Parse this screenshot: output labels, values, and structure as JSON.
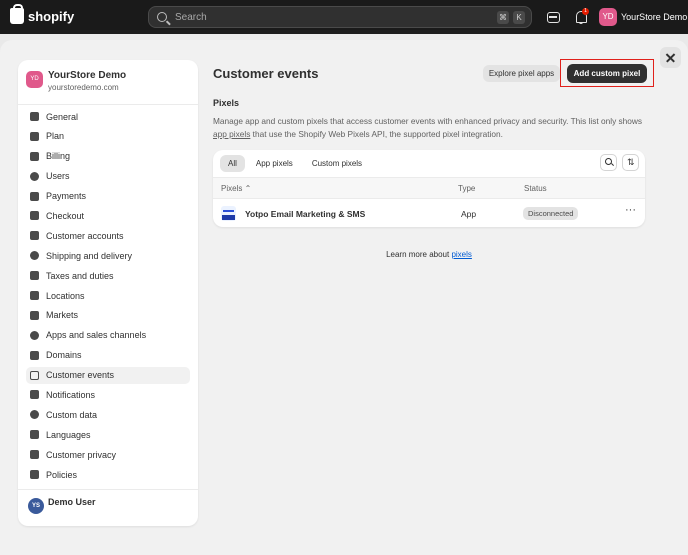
{
  "topbar": {
    "brand": "shopify",
    "search_placeholder": "Search",
    "shortcut_keys": [
      "⌘",
      "K"
    ],
    "notification_count": "1",
    "store_initials": "YD",
    "store_name": "YourStore Demo"
  },
  "sidebar": {
    "store_initials": "YD",
    "store_name": "YourStore Demo",
    "store_url": "yourstoredemo.com",
    "items": [
      {
        "label": "General",
        "icon": "home-icon"
      },
      {
        "label": "Plan",
        "icon": "chart-icon"
      },
      {
        "label": "Billing",
        "icon": "billing-icon"
      },
      {
        "label": "Users",
        "icon": "users-icon"
      },
      {
        "label": "Payments",
        "icon": "payments-icon"
      },
      {
        "label": "Checkout",
        "icon": "cart-icon"
      },
      {
        "label": "Customer accounts",
        "icon": "person-icon"
      },
      {
        "label": "Shipping and delivery",
        "icon": "truck-icon"
      },
      {
        "label": "Taxes and duties",
        "icon": "tax-icon"
      },
      {
        "label": "Locations",
        "icon": "location-icon"
      },
      {
        "label": "Markets",
        "icon": "globe-icon"
      },
      {
        "label": "Apps and sales channels",
        "icon": "apps-icon"
      },
      {
        "label": "Domains",
        "icon": "domain-icon"
      },
      {
        "label": "Customer events",
        "icon": "events-icon",
        "active": true
      },
      {
        "label": "Notifications",
        "icon": "bell-icon"
      },
      {
        "label": "Custom data",
        "icon": "data-icon"
      },
      {
        "label": "Languages",
        "icon": "language-icon"
      },
      {
        "label": "Customer privacy",
        "icon": "lock-icon"
      },
      {
        "label": "Policies",
        "icon": "policy-icon"
      }
    ],
    "user_initials": "YS",
    "user_name": "Demo User"
  },
  "main": {
    "title": "Customer events",
    "explore_button": "Explore pixel apps",
    "add_button": "Add custom pixel",
    "section_title": "Pixels",
    "description_part1": "Manage app and custom pixels that access customer events with enhanced privacy and security. This list only shows ",
    "description_link": "app pixels",
    "description_part2": " that use the Shopify Web Pixels API, the supported pixel integration.",
    "tabs": [
      "All",
      "App pixels",
      "Custom pixels"
    ],
    "table": {
      "headers": {
        "pixels": "Pixels",
        "type": "Type",
        "status": "Status"
      },
      "sort_indicator": "⌃",
      "rows": [
        {
          "name": "Yotpo Email Marketing & SMS",
          "type": "App",
          "status": "Disconnected"
        }
      ]
    },
    "learn_prefix": "Learn more about ",
    "learn_link": "pixels"
  }
}
